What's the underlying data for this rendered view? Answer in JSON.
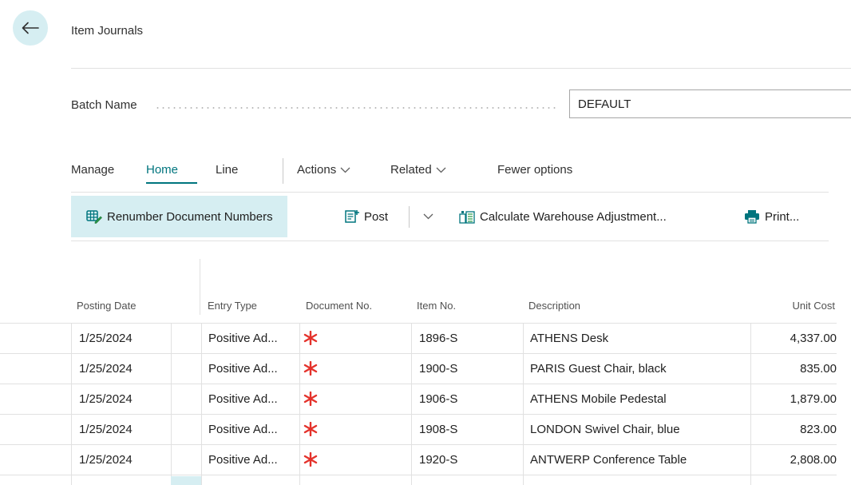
{
  "header": {
    "title": "Item Journals"
  },
  "batch": {
    "label": "Batch Name",
    "value": "DEFAULT"
  },
  "menu": {
    "items": [
      {
        "label": "Manage"
      },
      {
        "label": "Home",
        "active": true
      },
      {
        "label": "Line"
      },
      {
        "label": "Actions",
        "icon": "chevron-down-icon"
      },
      {
        "label": "Related",
        "icon": "chevron-down-icon"
      },
      {
        "label": "Fewer options"
      }
    ]
  },
  "actions": {
    "renumber": {
      "label": "Renumber Document Numbers",
      "icon": "renumber-icon"
    },
    "post": {
      "label": "Post",
      "icon": "post-icon",
      "dropdown_icon": "chevron-down-icon"
    },
    "calculate": {
      "label": "Calculate Warehouse Adjustment...",
      "icon": "calculate-icon"
    },
    "print": {
      "label": "Print...",
      "icon": "printer-icon"
    }
  },
  "table": {
    "columns": [
      "Posting Date",
      "Entry Type",
      "Document No.",
      "Item No.",
      "Description",
      "Unit Cost"
    ],
    "required_icon": "required-asterisk-icon",
    "required_color": "#e4322b",
    "rows": [
      {
        "posting_date": "1/25/2024",
        "entry_type": "Positive Ad...",
        "document_no": "",
        "item_no": "1896-S",
        "description": "ATHENS Desk",
        "unit_cost": "4,337.00"
      },
      {
        "posting_date": "1/25/2024",
        "entry_type": "Positive Ad...",
        "document_no": "",
        "item_no": "1900-S",
        "description": "PARIS Guest Chair, black",
        "unit_cost": "835.00"
      },
      {
        "posting_date": "1/25/2024",
        "entry_type": "Positive Ad...",
        "document_no": "",
        "item_no": "1906-S",
        "description": "ATHENS Mobile Pedestal",
        "unit_cost": "1,879.00"
      },
      {
        "posting_date": "1/25/2024",
        "entry_type": "Positive Ad...",
        "document_no": "",
        "item_no": "1908-S",
        "description": "LONDON Swivel Chair, blue",
        "unit_cost": "823.00"
      },
      {
        "posting_date": "1/25/2024",
        "entry_type": "Positive Ad...",
        "document_no": "",
        "item_no": "1920-S",
        "description": "ANTWERP Conference Table",
        "unit_cost": "2,808.00"
      }
    ]
  },
  "colors": {
    "accent": "#00757e",
    "highlight": "#d6eef2"
  }
}
